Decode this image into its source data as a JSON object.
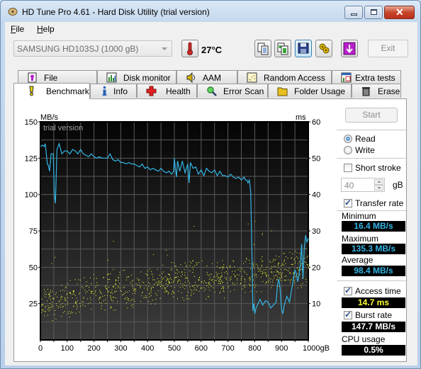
{
  "window": {
    "title": "HD Tune Pro 4.61 - Hard Disk Utility (trial version)",
    "controls": [
      "minimize",
      "maximize",
      "close"
    ]
  },
  "menu": [
    {
      "label": "File",
      "accel": "F",
      "rest": "ile"
    },
    {
      "label": "Help",
      "accel": "H",
      "rest": "elp"
    }
  ],
  "toolbar": {
    "drive": "SAMSUNG HD103SJ (1000 gB)",
    "temperature": "27°C",
    "icons": [
      "copy-text-icon",
      "copy-screenshot-icon",
      "save-icon",
      "options-icon",
      "download-icon"
    ],
    "exit_label": "Exit"
  },
  "tabs": {
    "row1": [
      "File Benchmark",
      "Disk monitor",
      "AAM",
      "Random Access",
      "Extra tests"
    ],
    "row2": [
      "Benchmark",
      "Info",
      "Health",
      "Error Scan",
      "Folder Usage",
      "Erase"
    ],
    "selected": "Benchmark"
  },
  "side": {
    "start_label": "Start",
    "read_label": "Read",
    "write_label": "Write",
    "mode": "Read",
    "short_stroke_label": "Short stroke",
    "short_stroke_checked": false,
    "short_stroke_value": "40",
    "short_stroke_unit": "gB",
    "transfer_rate_label": "Transfer rate",
    "transfer_rate_checked": true,
    "minimum_label": "Minimum",
    "minimum_value": "16.4 MB/s",
    "maximum_label": "Maximum",
    "maximum_value": "135.3 MB/s",
    "average_label": "Average",
    "average_value": "98.4 MB/s",
    "access_time_label": "Access time",
    "access_time_checked": true,
    "access_time_value": "14.7 ms",
    "burst_rate_label": "Burst rate",
    "burst_rate_checked": true,
    "burst_rate_value": "147.7 MB/s",
    "cpu_label": "CPU usage",
    "cpu_value": "0.5%",
    "colors": {
      "transfer": "#33b5e5",
      "access": "#ffff33",
      "burst": "#ffffff"
    }
  },
  "chart_data": {
    "type": "line",
    "watermark": "trial version",
    "xlabel": "gB",
    "ylabel_left": "MB/s",
    "ylabel_right": "ms",
    "xlim": [
      0,
      1000
    ],
    "ylim_left": [
      0,
      150
    ],
    "ylim_right": [
      0,
      60
    ],
    "x_ticks": [
      "0",
      "100",
      "200",
      "300",
      "400",
      "500",
      "600",
      "700",
      "800",
      "900",
      "1000gB"
    ],
    "y_ticks_left": [
      "150",
      "125",
      "100",
      "75",
      "50",
      "25"
    ],
    "y_ticks_right": [
      "60",
      "50",
      "40",
      "30",
      "20",
      "10"
    ],
    "grid": true,
    "series": [
      {
        "name": "Transfer rate (MB/s)",
        "color": "#33b5e5",
        "x": [
          0,
          8,
          14,
          18,
          22,
          26,
          30,
          34,
          40,
          45,
          48,
          52,
          56,
          62,
          70,
          80,
          90,
          100,
          110,
          120,
          130,
          140,
          150,
          160,
          170,
          180,
          190,
          200,
          210,
          220,
          230,
          240,
          250,
          260,
          270,
          280,
          290,
          300,
          310,
          320,
          330,
          340,
          350,
          360,
          370,
          380,
          390,
          400,
          410,
          420,
          430,
          440,
          450,
          460,
          470,
          480,
          490,
          497,
          500,
          504,
          508,
          512,
          520,
          530,
          540,
          550,
          555,
          560,
          570,
          580,
          590,
          600,
          610,
          620,
          630,
          640,
          650,
          660,
          670,
          680,
          690,
          700,
          710,
          720,
          730,
          740,
          750,
          760,
          765,
          770,
          775,
          780,
          785,
          790,
          793,
          796,
          800,
          805,
          810,
          820,
          830,
          840,
          850,
          860,
          870,
          880,
          885,
          890,
          895,
          900,
          905,
          910,
          920,
          930,
          940,
          950,
          955,
          960,
          965,
          970,
          975,
          980,
          985,
          990,
          995,
          1000
        ],
        "values": [
          133,
          134,
          133,
          135,
          128,
          121,
          120,
          116,
          128,
          128,
          128,
          100,
          94,
          131,
          135,
          128,
          130,
          130,
          128,
          131,
          130,
          128,
          131,
          128,
          127,
          126,
          128,
          126,
          125,
          126,
          125,
          125,
          125,
          128,
          124,
          123,
          124,
          122,
          122,
          121,
          122,
          121,
          121,
          120,
          119,
          121,
          118,
          119,
          117,
          118,
          117,
          116,
          118,
          116,
          115,
          116,
          114,
          116,
          125,
          118,
          112,
          123,
          116,
          123,
          115,
          121,
          108,
          122,
          118,
          119,
          114,
          117,
          113,
          118,
          116,
          115,
          117,
          113,
          116,
          113,
          113,
          112,
          114,
          112,
          111,
          112,
          110,
          112,
          110,
          110,
          108,
          110,
          102,
          56,
          20,
          25,
          18,
          22,
          24,
          28,
          24,
          27,
          26,
          22,
          24,
          26,
          38,
          42,
          35,
          21,
          18,
          24,
          30,
          26,
          37,
          48,
          46,
          40,
          44,
          52,
          66,
          42,
          63,
          72,
          67,
          70
        ]
      },
      {
        "name": "Access time (ms)",
        "color": "#ffff33",
        "type": "scatter",
        "description": "~1000 scattered points rising from ~5-15 ms at 0 gB to ~12-24 ms at 1000 gB; outliers up to ~29 ms",
        "trend_x": [
          0,
          100,
          200,
          300,
          400,
          500,
          600,
          700,
          800,
          900,
          1000
        ],
        "trend_mean_ms": [
          9.5,
          11.5,
          13,
          14,
          15,
          16,
          16.5,
          17,
          18,
          19,
          20
        ],
        "spread_ms": [
          5,
          6,
          6,
          6,
          6,
          6,
          6,
          6,
          6,
          6,
          6
        ]
      }
    ]
  }
}
